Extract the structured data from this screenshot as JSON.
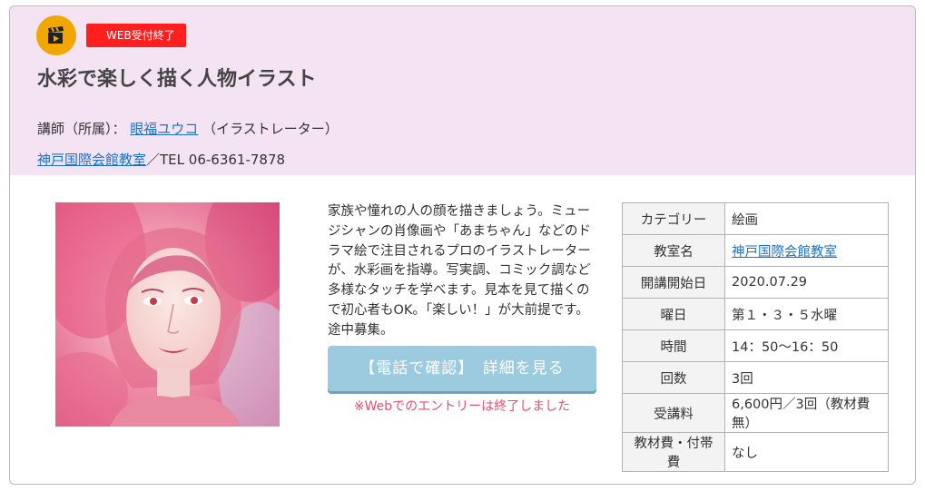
{
  "header": {
    "badge_icon": "movie-clapper-icon",
    "status_tag": "WEB受付終了",
    "title": "水彩で楽しく描く人物イラスト",
    "instructor_label": "講師（所属）：",
    "instructor_name": "眼福ユウコ",
    "instructor_affiliation": "（イラストレーター）",
    "venue_name": "神戸国際会館教室",
    "venue_tel": "／TEL 06-6361-7878"
  },
  "course": {
    "image_subject": "watercolor-portrait-of-a-woman",
    "description": "家族や憧れの人の顔を描きましょう。ミュージシャンの肖像画や「あまちゃん」などのドラマ絵で注目されるプロのイラストレーターが、水彩画を指導。写実調、コミック調など多様なタッチを学べます。見本を見て描くので初心者もOK。「楽しい！」が大前提です。途中募集。",
    "button_label": "【電話で確認】　詳細を見る",
    "closed_notice": "※Webでのエントリーは終了しました"
  },
  "info": [
    {
      "label": "カテゴリー",
      "value": "絵画"
    },
    {
      "label": "教室名",
      "value": "神戸国際会館教室"
    },
    {
      "label": "開講開始日",
      "value": "2020.07.29"
    },
    {
      "label": "曜日",
      "value": "第１・３・５水曜"
    },
    {
      "label": "時間",
      "value": "14：50〜16：50"
    },
    {
      "label": "回数",
      "value": "3回"
    },
    {
      "label": "受講料",
      "value": "6,600円／3回（教材費無）"
    },
    {
      "label": "教材費・付帯費",
      "value": "なし"
    }
  ],
  "colors": {
    "header_bg": "#f3e3f3",
    "badge": "#f0a800",
    "status_tag": "#ff1f1f",
    "button": "#9ccbe0",
    "notice": "#e64d72",
    "link": "#1a73c9"
  }
}
